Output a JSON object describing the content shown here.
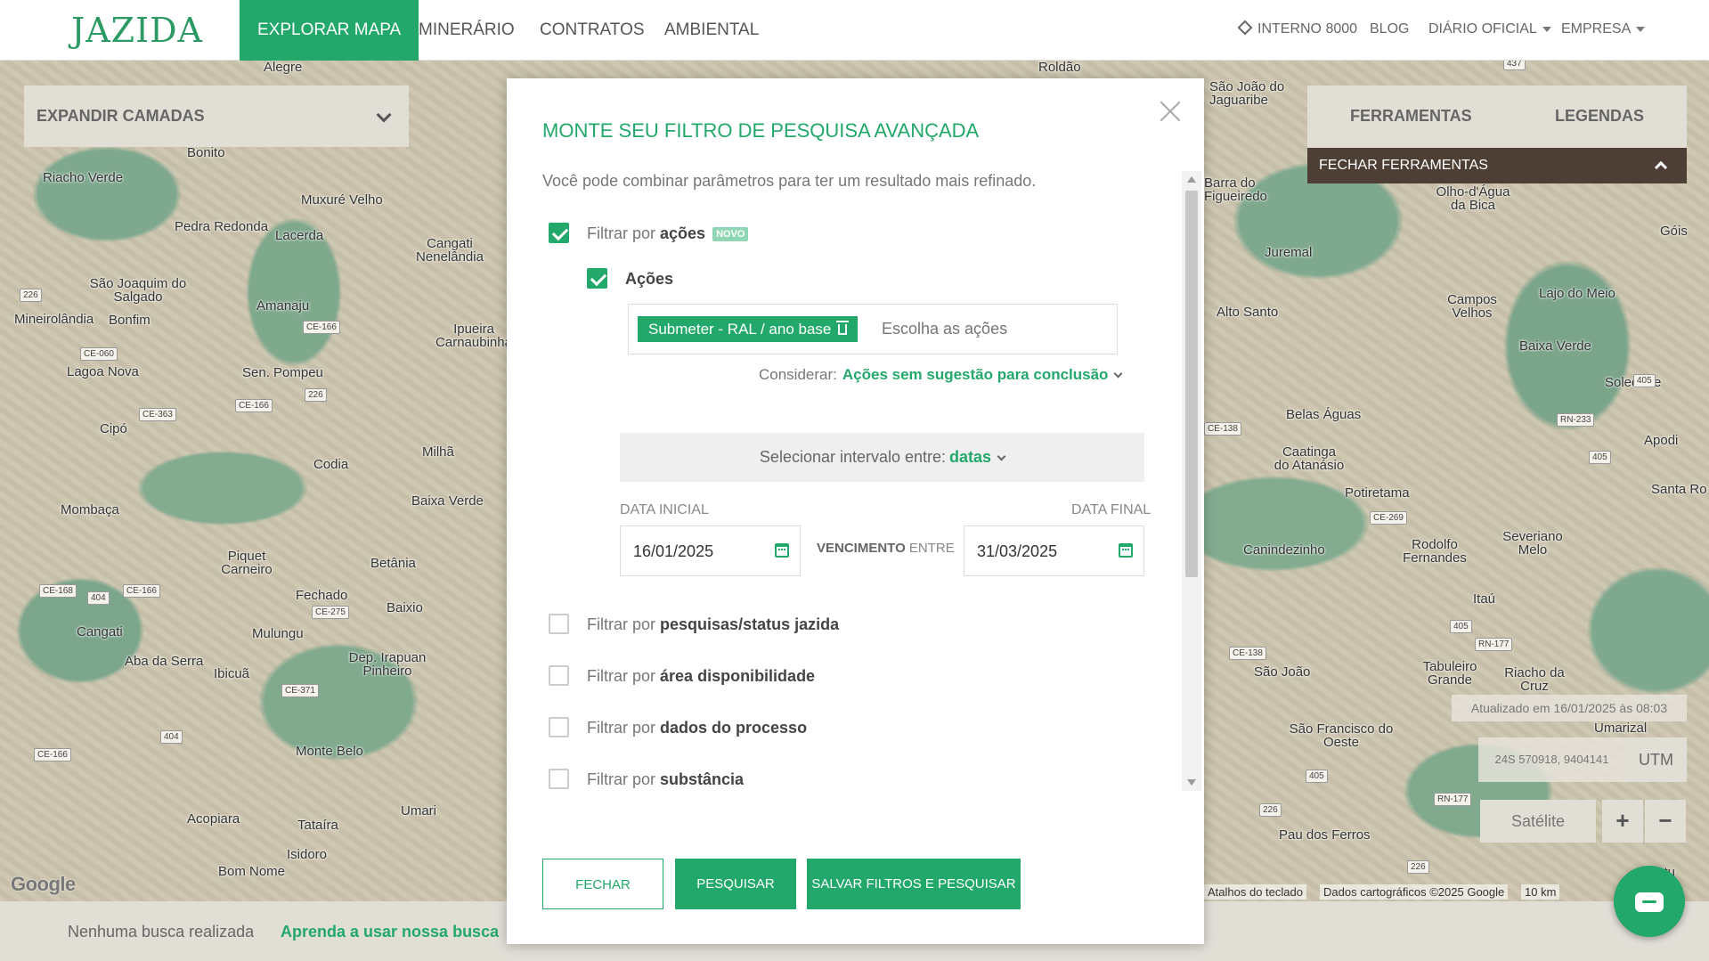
{
  "nav": {
    "logo": "JAZIDA",
    "items": [
      "EXPLORAR MAPA",
      "MINERÁRIO",
      "CONTRATOS",
      "AMBIENTAL"
    ],
    "interno": "INTERNO 8000",
    "blog": "BLOG",
    "diario": "DIÁRIO OFICIAL",
    "empresa": "EMPRESA"
  },
  "map": {
    "layers_label": "EXPANDIR CAMADAS",
    "tools_tab": "FERRAMENTAS",
    "legends_tab": "LEGENDAS",
    "close_tools": "FECHAR FERRAMENTAS",
    "updated": "Atualizado em 16/01/2025 às 08:03",
    "coords": "24S 570918, 9404141",
    "utm": "UTM",
    "satellite": "Satélite",
    "zoom_in": "+",
    "zoom_out": "−",
    "google": "Google",
    "attrib_keys": "Atalhos do teclado",
    "attrib_data": "Dados cartográficos ©2025 Google",
    "attrib_scale": "10 km",
    "towns": [
      "Alegre",
      "Roldão",
      "São João do Jaguaribe",
      "Bonito",
      "Riacho Verde",
      "Muxuré Velho",
      "Pedra Redonda",
      "Lacerda",
      "Cangati Nenelândia",
      "São Joaquim do Salgado",
      "Amanaju",
      "Mineirolândia",
      "Bonfim",
      "Ipueira Carnaubinha",
      "Lagoa Nova",
      "Sen. Pompeu",
      "Cipó",
      "Milhã",
      "Codia",
      "Mombaça",
      "Baixa Verde",
      "Piquet Carneiro",
      "Betânia",
      "Fechado",
      "Baixio",
      "Cangati",
      "Mulungu",
      "Aba da Serra",
      "Ibicuã",
      "Dep. Irapuan Pinheiro",
      "Monte Belo",
      "Acopiara",
      "Tataíra",
      "Umari",
      "Isidoro",
      "Bom Nome",
      "Barra do Figueiredo",
      "Olho-d'Água da Bica",
      "Juremal",
      "Alto Santo",
      "Campos Velhos",
      "Lajo do Meio",
      "Baixa Verde",
      "Soledade",
      "Belas Águas",
      "Caatinga do Atanásio",
      "Potiretama",
      "Apodi",
      "Canindezinho",
      "Rodolfo Fernandes",
      "Severiano Melo",
      "Itaú",
      "São João",
      "Tabuleiro Grande",
      "Riacho da Cruz",
      "Umarizal",
      "São Francisco do Oeste",
      "Pau dos Ferros",
      "Frutu",
      "Góis",
      "Santa Ro"
    ]
  },
  "bottom": {
    "status": "Nenhuma busca realizada",
    "learn": "Aprenda a usar nossa busca"
  },
  "modal": {
    "title": "MONTE SEU FILTRO DE PESQUISA AVANÇADA",
    "subtitle": "Você pode combinar parâmetros para ter um resultado mais refinado.",
    "filter_prefix": "Filtrar por",
    "filters": [
      {
        "name": "ações",
        "checked": true,
        "badge": "NOVO"
      },
      {
        "name": "pesquisas/status jazida",
        "checked": false
      },
      {
        "name": "área disponibilidade",
        "checked": false
      },
      {
        "name": "dados do processo",
        "checked": false
      },
      {
        "name": "substância",
        "checked": false
      }
    ],
    "acoes_label": "Ações",
    "tag": "Submeter - RAL / ano base",
    "tag_placeholder": "Escolha as ações",
    "consider_label": "Considerar:",
    "consider_value": "Ações sem sugestão para conclusão",
    "interval_label": "Selecionar intervalo entre:",
    "interval_value": "datas",
    "date_start_label": "DATA INICIAL",
    "date_end_label": "DATA FINAL",
    "date_start": "16/01/2025",
    "date_end": "31/03/2025",
    "venc_bold": "VENCIMENTO",
    "venc_rest": "ENTRE",
    "btn_close": "FECHAR",
    "btn_search": "PESQUISAR",
    "btn_save": "SALVAR FILTROS E PESQUISAR"
  },
  "colors": {
    "brand": "#22a86a",
    "tools_bar": "#4d3f36"
  }
}
